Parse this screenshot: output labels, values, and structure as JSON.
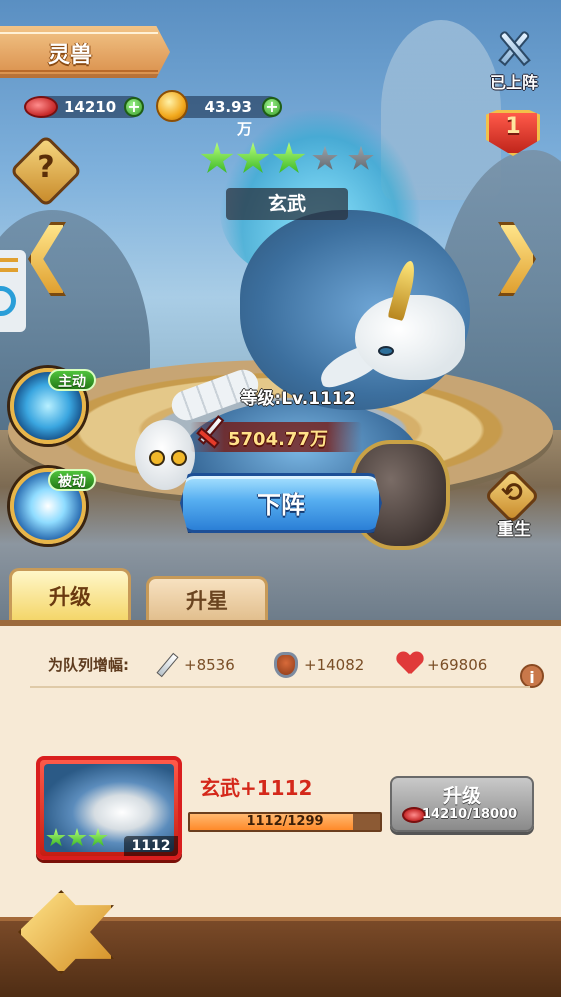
{
  "header": {
    "title": "灵兽"
  },
  "resources": {
    "meat": {
      "icon": "meat-icon",
      "value": "14210"
    },
    "gold": {
      "icon": "gold-coin-icon",
      "value": "43.93万"
    }
  },
  "deploy_status": {
    "label": "已上阵",
    "rank": "1"
  },
  "beast": {
    "name": "玄武",
    "stars_total": 5,
    "stars_filled": 3,
    "level_text": "等级:Lv.1112",
    "power": "5704.77万"
  },
  "skills": {
    "active_label": "主动",
    "passive_label": "被动"
  },
  "buttons": {
    "unequip": "下阵",
    "rebirth": "重生",
    "help": "?"
  },
  "tabs": [
    {
      "label": "升级",
      "selected": true
    },
    {
      "label": "升星",
      "selected": false
    }
  ],
  "boost": {
    "label": "为队列增幅:",
    "attack": "+8536",
    "defense": "+14082",
    "hp": "+69806"
  },
  "upgrade_card": {
    "card_level": "1112",
    "card_stars": 3,
    "name_level": "玄武+1112",
    "exp_text": "1112/1299",
    "exp_current": 1112,
    "exp_max": 1299,
    "button_label": "升级",
    "cost_text": "14210/18000"
  },
  "colors": {
    "accent_gold": "#e8b64a",
    "title_banner": "#d98e4a",
    "danger_red": "#d4281a",
    "button_blue": "#2b7fd6"
  }
}
